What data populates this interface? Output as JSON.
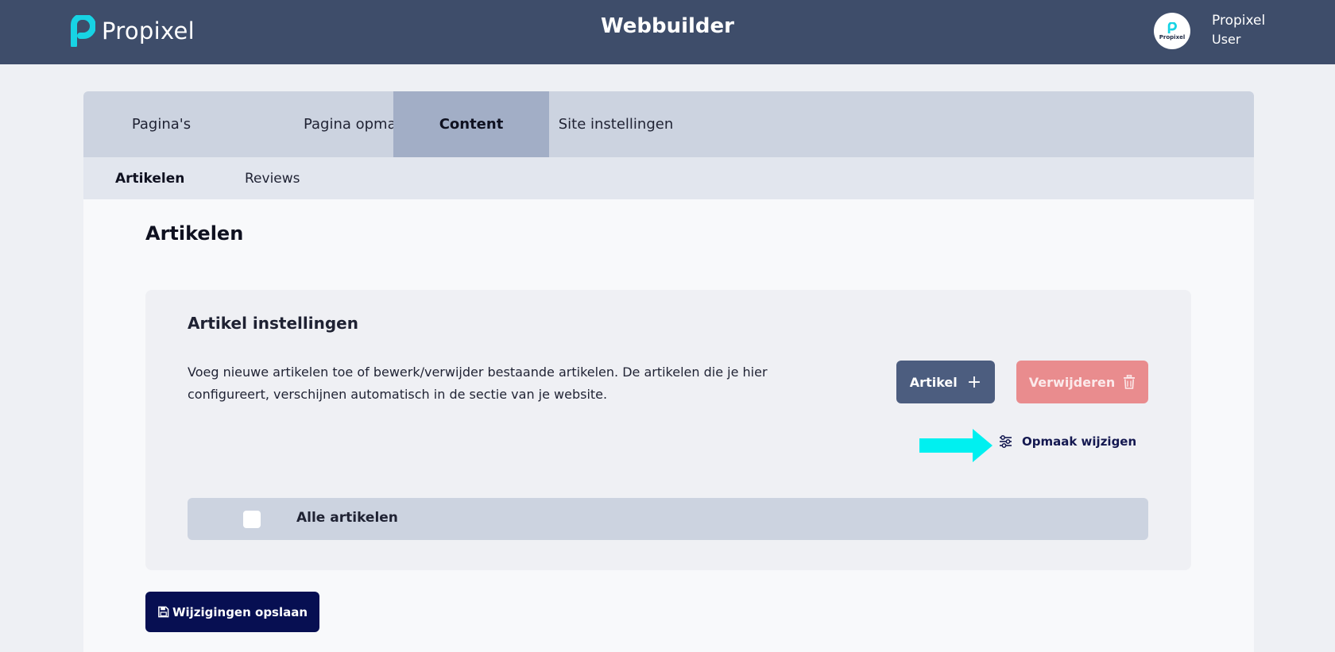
{
  "header": {
    "brand_name": "Propixel",
    "app_title": "Webbuilder",
    "avatar_text": "Propixel",
    "user_name": "Propixel",
    "user_role": "User"
  },
  "main_tabs": [
    {
      "label": "Pagina's",
      "active": false
    },
    {
      "label": "Pagina opmaak",
      "active": false
    },
    {
      "label": "Content",
      "active": true
    },
    {
      "label": "Site instellingen",
      "active": false
    }
  ],
  "sub_tabs": [
    {
      "label": "Artikelen",
      "active": true
    },
    {
      "label": "Reviews",
      "active": false
    }
  ],
  "page_title": "Artikelen",
  "card": {
    "title": "Artikel instellingen",
    "description": "Voeg nieuwe artikelen toe of bewerk/verwijder bestaande artikelen. De artikelen die je hier configureert, verschijnen automatisch in de sectie van je website.",
    "add_button": "Artikel",
    "add_icon": "+",
    "delete_button": "Verwijderen",
    "edit_layout_link": "Opmaak wijzigen",
    "all_items_label": "Alle artikelen",
    "select_all_checked": false
  },
  "save_button": "Wijzigingen opslaan",
  "icons": {
    "brand": "propixel-logo-icon",
    "add": "plus-icon",
    "delete": "trash-icon",
    "edit": "sliders-icon",
    "save": "save-icon",
    "annotation": "arrow-right-icon"
  },
  "colors": {
    "topbar": "#3e4d6a",
    "brand_accent": "#17d3e4",
    "active_tab": "#a2aec6",
    "add_button": "#4c5d7f",
    "delete_button": "#e98c8e",
    "save_button": "#070f52",
    "annotation_arrow": "#00f0f0"
  }
}
